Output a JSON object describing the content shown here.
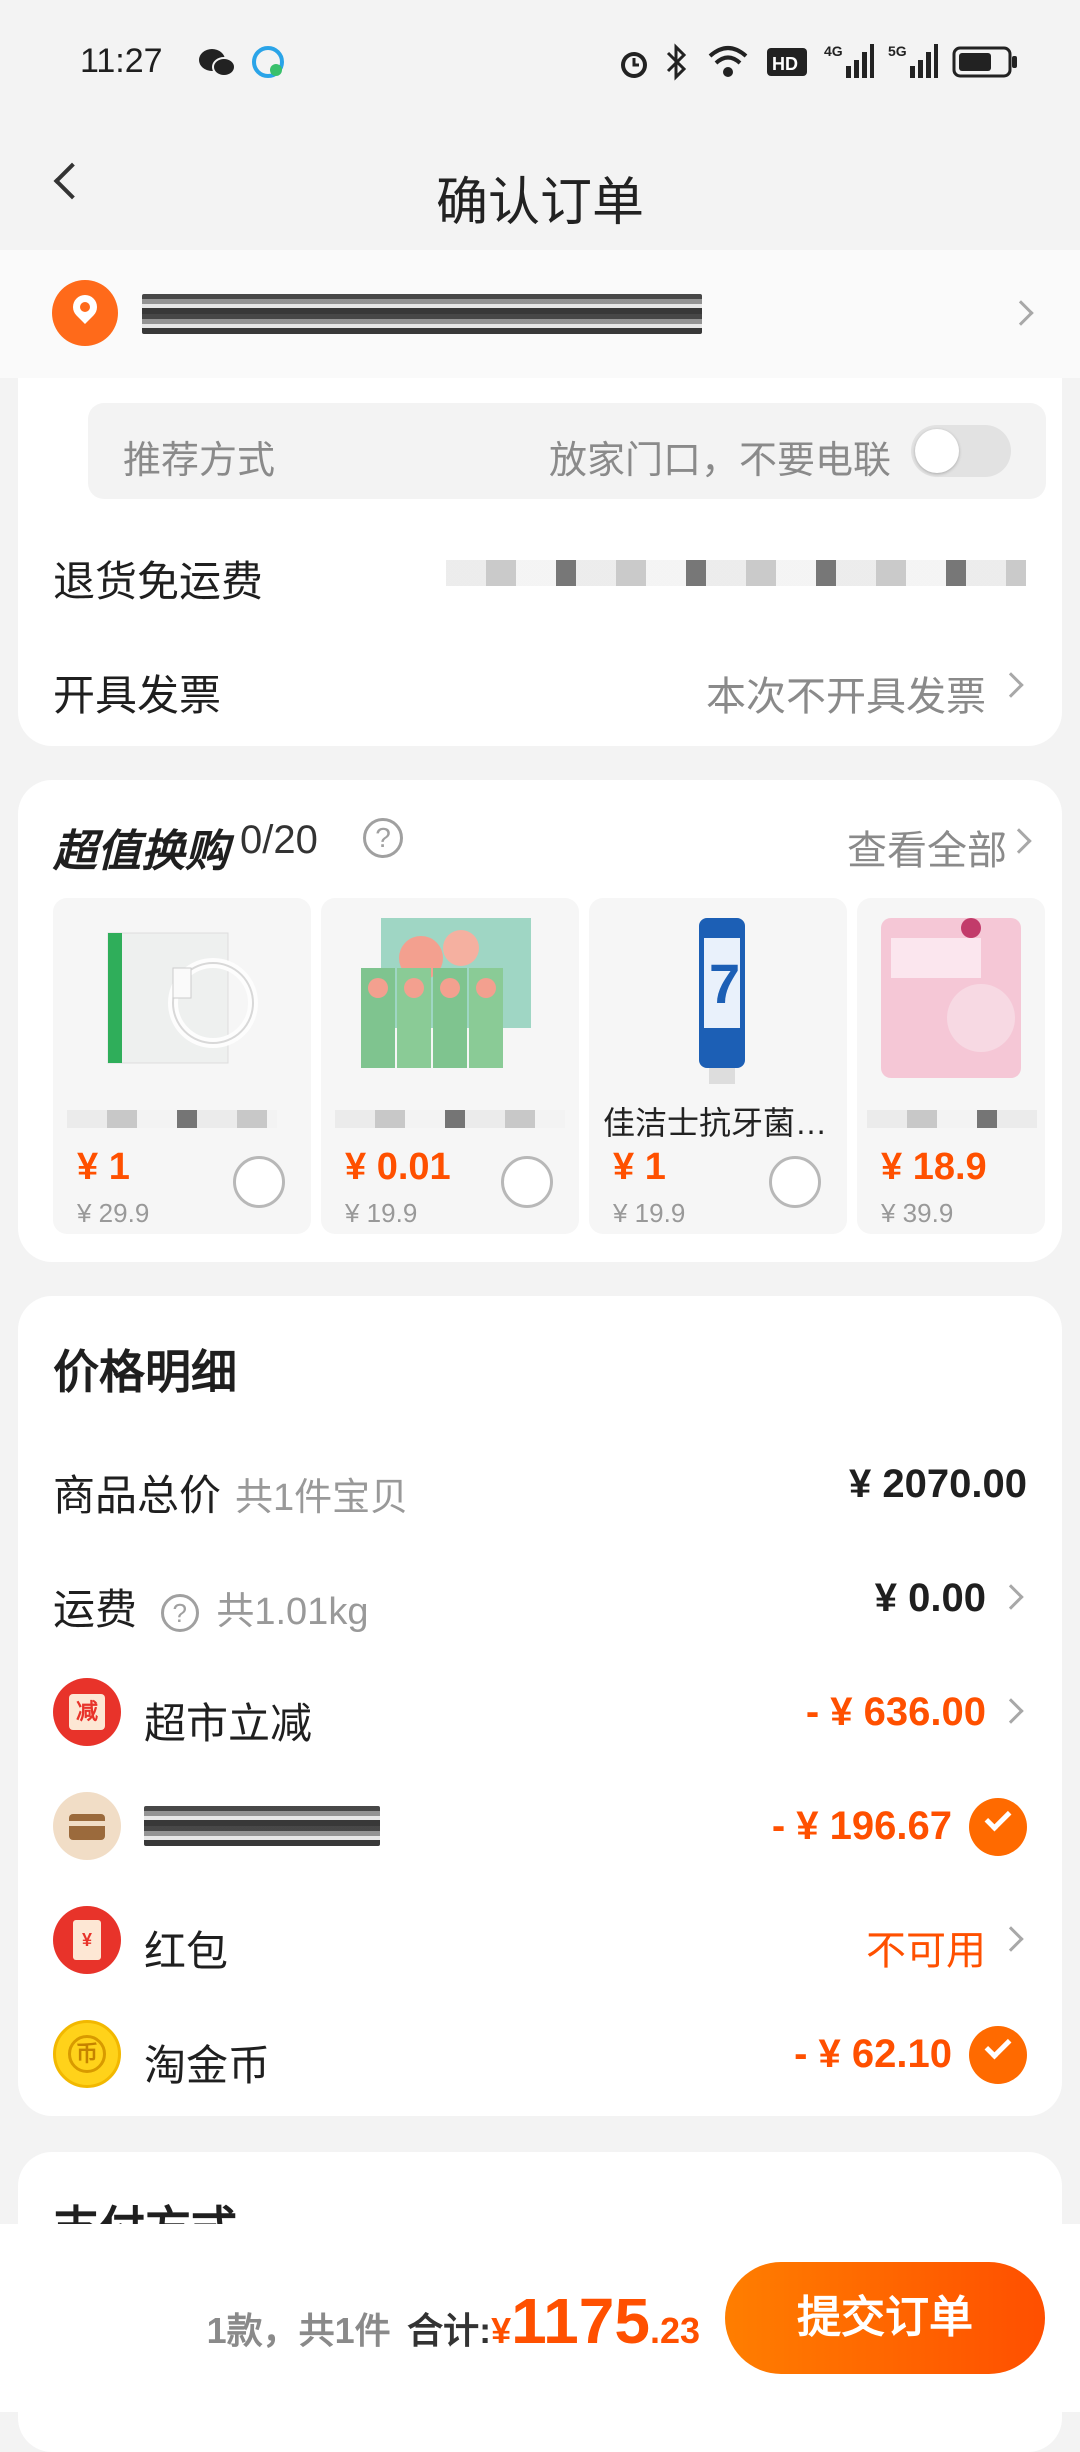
{
  "status_bar": {
    "time": "11:27",
    "icons": [
      "wechat-icon",
      "message-icon",
      "alarm-icon",
      "bluetooth-icon",
      "wifi-icon",
      "hd-icon",
      "signal-4g-icon",
      "signal-5g-icon",
      "battery-icon"
    ]
  },
  "nav": {
    "title": "确认订单"
  },
  "delivery": {
    "pref_label": "推荐方式",
    "pref_value": "放家门口，不要电联",
    "return_label": "退货免运费",
    "invoice_label": "开具发票",
    "invoice_value": "本次不开具发票"
  },
  "deals": {
    "title": "超值换购",
    "count": "0/20",
    "view_all": "查看全部",
    "items": [
      {
        "name": "",
        "price": "¥ 1",
        "orig": "¥ 29.9"
      },
      {
        "name": "",
        "price": "¥ 0.01",
        "orig": "¥ 19.9"
      },
      {
        "name": "佳洁士抗牙菌…",
        "price": "¥ 1",
        "orig": "¥ 19.9"
      },
      {
        "name": "",
        "price": "¥ 18.9",
        "orig": "¥ 39.9"
      }
    ]
  },
  "price": {
    "title": "价格明细",
    "total_label": "商品总价",
    "total_sub": "共1件宝贝",
    "total_amount": "¥ 2070.00",
    "shipping_label": "运费",
    "shipping_sub": "共1.01kg",
    "shipping_amount": "¥ 0.00",
    "discount_label": "超市立减",
    "discount_amount": "- ¥ 636.00",
    "card_amount": "- ¥ 196.67",
    "redpack_label": "红包",
    "redpack_value": "不可用",
    "coin_label": "淘金币",
    "coin_amount": "- ¥ 62.10"
  },
  "payment": {
    "title": "支付方式"
  },
  "bottom": {
    "count": "1款，共1件",
    "total_label": "合计:",
    "currency": "¥",
    "total_big": "1175",
    "total_small": ".23",
    "submit": "提交订单"
  },
  "colors": {
    "accent": "#ff5000",
    "check": "#ff6a00",
    "bg": "#f3f3f3"
  }
}
